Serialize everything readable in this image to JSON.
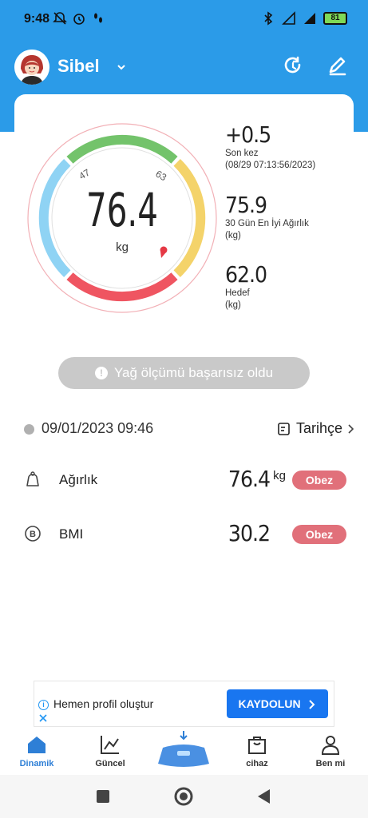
{
  "status_bar": {
    "time": "9:48",
    "battery": "81"
  },
  "profile": {
    "name": "Sibel"
  },
  "gauge": {
    "value": "76.4",
    "unit": "kg",
    "tick_low": "47",
    "tick_high": "63"
  },
  "stats": [
    {
      "value": "+0.5",
      "label1": "Son kez",
      "label2": "(08/29 07:13:56/2023)"
    },
    {
      "value": "75.9",
      "label1": "30 Gün En İyi Ağırlık",
      "label2": "(kg)"
    },
    {
      "value": "62.0",
      "label1": "Hedef",
      "label2": "(kg)"
    }
  ],
  "notice": {
    "text": "Yağ ölçümü başarısız oldu",
    "icon": "!"
  },
  "measurement": {
    "datetime": "09/01/2023 09:46",
    "history_label": "Tarihçe"
  },
  "metrics": [
    {
      "name": "Ağırlık",
      "value": "76.4",
      "unit": "kg",
      "badge": "Obez"
    },
    {
      "name": "BMI",
      "value": "30.2",
      "unit": "",
      "badge": "Obez"
    }
  ],
  "ad": {
    "text": "Hemen profil oluştur",
    "button": "KAYDOLUN"
  },
  "tabs": [
    {
      "label": "Dinamik",
      "icon": "home-icon"
    },
    {
      "label": "Güncel",
      "icon": "chart-icon"
    },
    {
      "label": "",
      "icon": "scale-icon"
    },
    {
      "label": "cihaz",
      "icon": "bag-icon"
    },
    {
      "label": "Ben mi",
      "icon": "user-icon"
    }
  ],
  "colors": {
    "header": "#2b9be8",
    "gauge_blue": "#8fd3f4",
    "gauge_green": "#73c36b",
    "gauge_yellow": "#f4d36a",
    "gauge_red": "#ef5561",
    "badge": "#e1707a",
    "ad_button": "#1976f0"
  }
}
